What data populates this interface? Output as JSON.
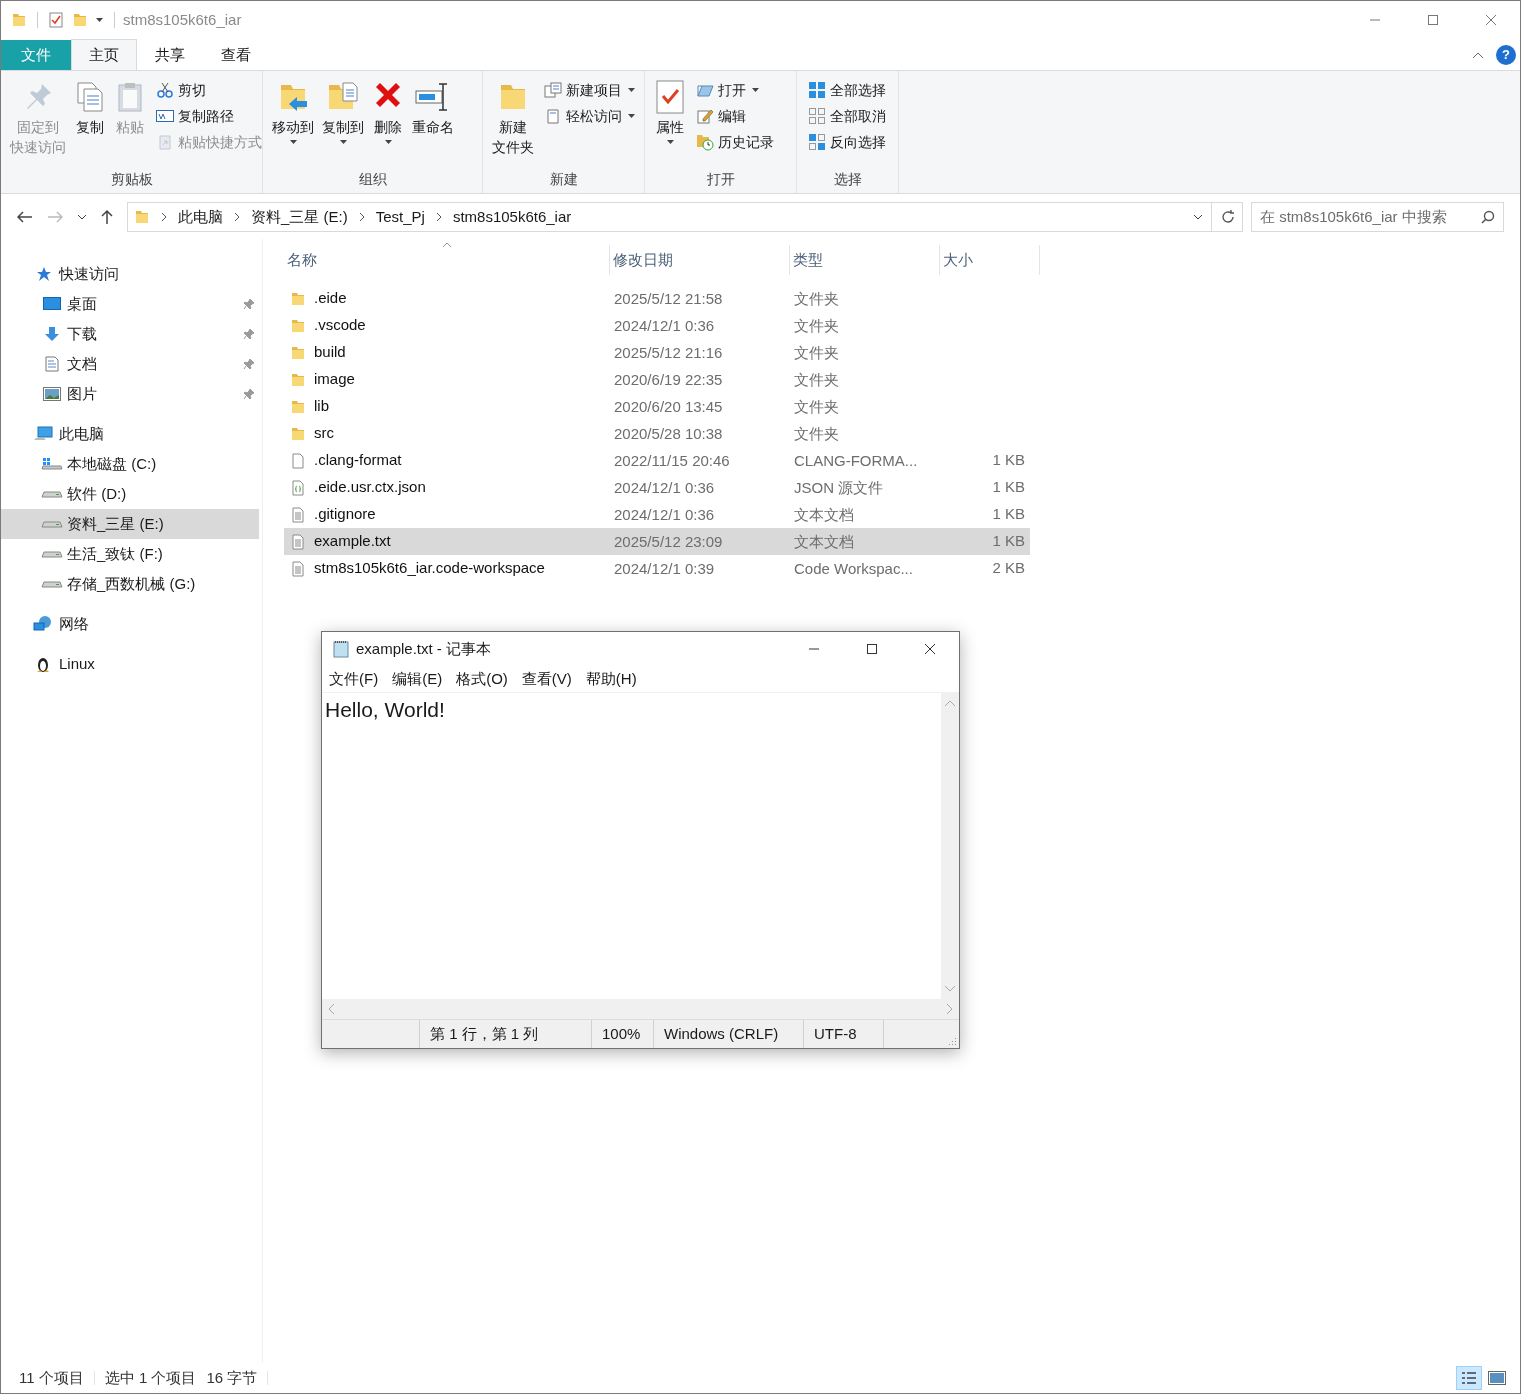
{
  "window": {
    "title": "stm8s105k6t6_iar"
  },
  "ribbon_tabs": [
    {
      "label": "文件",
      "kind": "file",
      "selected": false
    },
    {
      "label": "主页",
      "kind": "tab",
      "selected": true
    },
    {
      "label": "共享",
      "kind": "tab",
      "selected": false
    },
    {
      "label": "查看",
      "kind": "tab",
      "selected": false
    }
  ],
  "help_button": "?",
  "ribbon_groups": [
    {
      "label": "剪贴板",
      "items": [
        {
          "kind": "large",
          "lines": [
            "固定到",
            "快速访问"
          ],
          "disabled": true,
          "menu": false
        },
        {
          "kind": "large",
          "label": "复制",
          "disabled": false,
          "menu": false
        },
        {
          "kind": "large",
          "label": "粘贴",
          "disabled": true,
          "menu": false
        },
        {
          "kind": "small",
          "label": "剪切",
          "disabled": false,
          "menu": false
        },
        {
          "kind": "small",
          "label": "复制路径",
          "disabled": false,
          "menu": false
        },
        {
          "kind": "small",
          "label": "粘贴快捷方式",
          "disabled": true,
          "menu": false
        }
      ]
    },
    {
      "label": "组织",
      "items": [
        {
          "kind": "large",
          "label": "移动到",
          "disabled": false,
          "menu": true
        },
        {
          "kind": "large",
          "label": "复制到",
          "disabled": false,
          "menu": true
        },
        {
          "kind": "large",
          "label": "删除",
          "disabled": false,
          "menu": true
        },
        {
          "kind": "large",
          "label": "重命名",
          "disabled": false,
          "menu": false
        }
      ]
    },
    {
      "label": "新建",
      "items": [
        {
          "kind": "large",
          "lines": [
            "新建",
            "文件夹"
          ],
          "disabled": false,
          "menu": false
        },
        {
          "kind": "small",
          "label": "新建项目",
          "disabled": false,
          "menu": true
        },
        {
          "kind": "small",
          "label": "轻松访问",
          "disabled": false,
          "menu": true
        }
      ]
    },
    {
      "label": "打开",
      "items": [
        {
          "kind": "large",
          "label": "属性",
          "disabled": false,
          "menu": true
        },
        {
          "kind": "small",
          "label": "打开",
          "disabled": false,
          "menu": true
        },
        {
          "kind": "small",
          "label": "编辑",
          "disabled": false,
          "menu": false
        },
        {
          "kind": "small",
          "label": "历史记录",
          "disabled": false,
          "menu": false
        }
      ]
    },
    {
      "label": "选择",
      "items": [
        {
          "kind": "small",
          "label": "全部选择",
          "disabled": false,
          "menu": false
        },
        {
          "kind": "small",
          "label": "全部取消",
          "disabled": false,
          "menu": false
        },
        {
          "kind": "small",
          "label": "反向选择",
          "disabled": false,
          "menu": false
        }
      ]
    }
  ],
  "address_bar": {
    "breadcrumbs": [
      "此电脑",
      "资料_三星 (E:)",
      "Test_Pj",
      "stm8s105k6t6_iar"
    ]
  },
  "search": {
    "placeholder": "在 stm8s105k6t6_iar 中搜索"
  },
  "navigation": [
    {
      "label": "快速访问",
      "selected": false,
      "children": [
        {
          "label": "桌面",
          "pinned": true,
          "selected": false
        },
        {
          "label": "下载",
          "pinned": true,
          "selected": false
        },
        {
          "label": "文档",
          "pinned": true,
          "selected": false
        },
        {
          "label": "图片",
          "pinned": true,
          "selected": false
        }
      ]
    },
    {
      "label": "此电脑",
      "selected": false,
      "children": [
        {
          "label": "本地磁盘 (C:)",
          "pinned": false,
          "selected": false
        },
        {
          "label": "软件 (D:)",
          "pinned": false,
          "selected": false
        },
        {
          "label": "资料_三星 (E:)",
          "pinned": false,
          "selected": true
        },
        {
          "label": "生活_致钛 (F:)",
          "pinned": false,
          "selected": false
        },
        {
          "label": "存储_西数机械 (G:)",
          "pinned": false,
          "selected": false
        }
      ]
    },
    {
      "label": "网络",
      "selected": false
    },
    {
      "label": "Linux",
      "selected": false
    }
  ],
  "table": {
    "columns": [
      {
        "label": "名称",
        "sorted": true
      },
      {
        "label": "修改日期",
        "sorted": false
      },
      {
        "label": "类型",
        "sorted": false
      },
      {
        "label": "大小",
        "sorted": false
      }
    ],
    "rows": [
      {
        "kind": "folder",
        "name": ".eide",
        "date": "2025/5/12 21:58",
        "type": "文件夹",
        "size": "",
        "selected": false
      },
      {
        "kind": "folder",
        "name": ".vscode",
        "date": "2024/12/1 0:36",
        "type": "文件夹",
        "size": "",
        "selected": false
      },
      {
        "kind": "folder",
        "name": "build",
        "date": "2025/5/12 21:16",
        "type": "文件夹",
        "size": "",
        "selected": false
      },
      {
        "kind": "folder",
        "name": "image",
        "date": "2020/6/19 22:35",
        "type": "文件夹",
        "size": "",
        "selected": false
      },
      {
        "kind": "folder",
        "name": "lib",
        "date": "2020/6/20 13:45",
        "type": "文件夹",
        "size": "",
        "selected": false
      },
      {
        "kind": "folder",
        "name": "src",
        "date": "2020/5/28 10:38",
        "type": "文件夹",
        "size": "",
        "selected": false
      },
      {
        "kind": "file",
        "name": ".clang-format",
        "date": "2022/11/15 20:46",
        "type": "CLANG-FORMA...",
        "size": "1 KB",
        "selected": false
      },
      {
        "kind": "json",
        "name": ".eide.usr.ctx.json",
        "date": "2024/12/1 0:36",
        "type": "JSON 源文件",
        "size": "1 KB",
        "selected": false
      },
      {
        "kind": "text",
        "name": ".gitignore",
        "date": "2024/12/1 0:36",
        "type": "文本文档",
        "size": "1 KB",
        "selected": false
      },
      {
        "kind": "text",
        "name": "example.txt",
        "date": "2025/5/12 23:09",
        "type": "文本文档",
        "size": "1 KB",
        "selected": true
      },
      {
        "kind": "text",
        "name": "stm8s105k6t6_iar.code-workspace",
        "date": "2024/12/1 0:39",
        "type": "Code Workspac...",
        "size": "2 KB",
        "selected": false
      }
    ]
  },
  "status_bar": {
    "item_count": "11 个项目",
    "selection": "选中 1 个项目",
    "selection_size": "16 字节",
    "views": [
      {
        "selected": true
      },
      {
        "selected": false
      }
    ]
  },
  "notepad": {
    "title": "example.txt - 记事本",
    "menus": [
      "文件(F)",
      "编辑(E)",
      "格式(O)",
      "查看(V)",
      "帮助(H)"
    ],
    "content": "Hello, World!",
    "status": [
      "第 1 行，第 1 列",
      "100%",
      "Windows (CRLF)",
      "UTF-8"
    ]
  }
}
